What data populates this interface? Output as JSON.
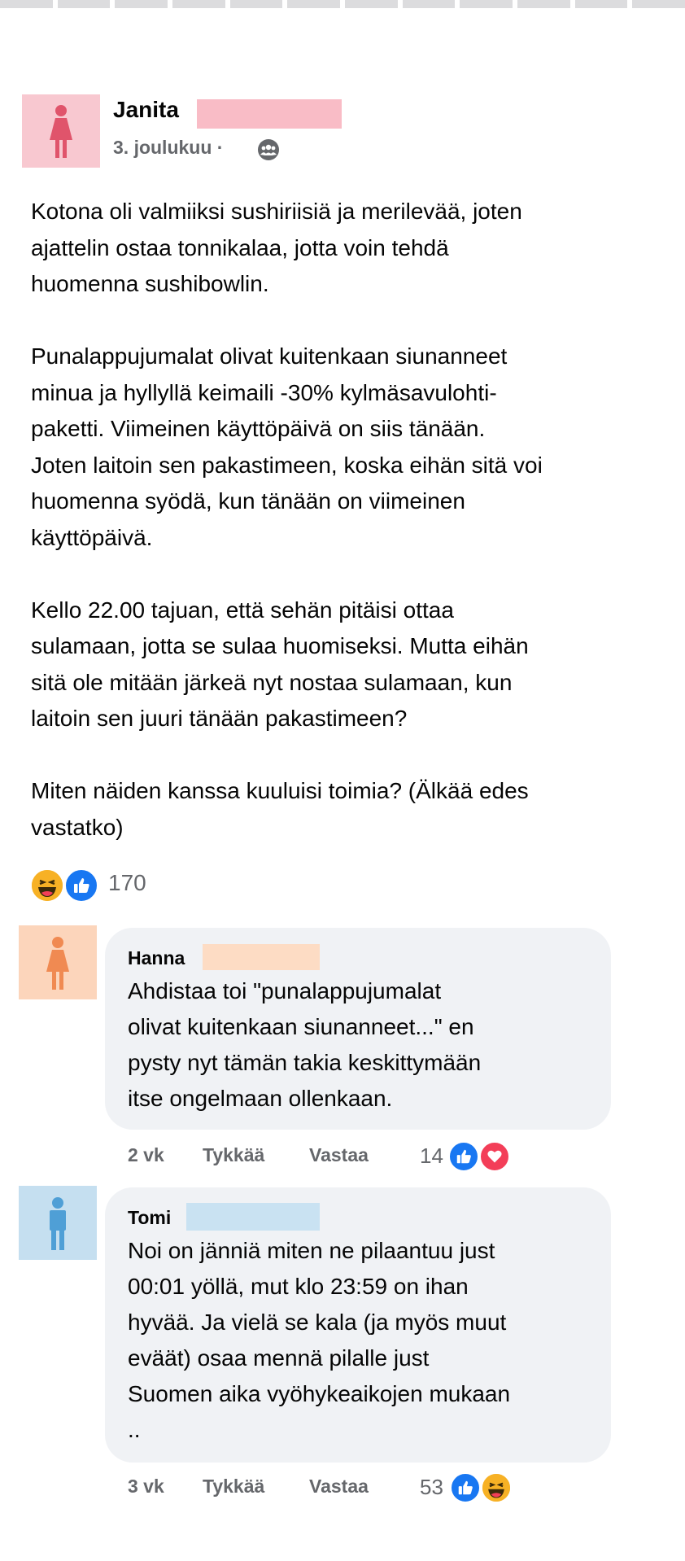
{
  "post": {
    "author": "Janita",
    "date": "3. joulukuu",
    "separator": "·",
    "privacy_icon": "group-icon",
    "text": "Kotona oli valmiiksi sushiriisiä ja merilevää, joten\najattelin ostaa tonnikalaa, jotta voin tehdä\nhuomenna sushibowlin.\n\nPunalappujumalat olivat kuitenkaan siunanneet\nminua ja hyllyllä keimaili -30% kylmäsavulohti-\npaketti. Viimeinen käyttöpäivä on siis tänään.\nJoten laitoin sen pakastimeen, koska eihän sitä voi\nhuomenna syödä, kun tänään on viimeinen\nkäyttöpäivä.\n\nKello 22.00 tajuan, että sehän pitäisi ottaa\nsulamaan, jotta se sulaa huomiseksi. Mutta eihän\nsitä ole mitään järkeä nyt nostaa sulamaan, kun\nlaitoin sen juuri tänään pakastimeen?\n\nMiten näiden kanssa kuuluisi toimia? (Älkää edes\nvastatko)",
    "reactions": {
      "icons": [
        "haha-icon",
        "like-icon"
      ],
      "count": "170"
    }
  },
  "comments": [
    {
      "author": "Hanna",
      "text": "Ahdistaa toi \"punalappujumalat\nolivat kuitenkaan siunanneet...\" en\npysty nyt tämän takia keskittymään\nitse ongelmaan ollenkaan.",
      "time": "2 vk",
      "like_label": "Tykkää",
      "reply_label": "Vastaa",
      "reaction_count": "14",
      "reaction_icons": [
        "like-icon",
        "love-icon"
      ]
    },
    {
      "author": "Tomi",
      "text": "Noi on jänniä miten ne pilaantuu just\n00:01 yöllä, mut klo 23:59 on ihan\nhyvää. Ja vielä se kala (ja myös muut\neväät) osaa mennä pilalle just\nSuomen aika vyöhykeaikojen mukaan\n..",
      "time": "3 vk",
      "like_label": "Tykkää",
      "reply_label": "Vastaa",
      "reaction_count": "53",
      "reaction_icons": [
        "like-icon",
        "haha-icon"
      ]
    }
  ],
  "colors": {
    "like_blue": "#1877f2",
    "love_red": "#f33e58",
    "haha_yellow": "#f7b125",
    "avatar_janita": "#f8c8d0",
    "avatar_hanna": "#fcd5bb",
    "avatar_tomi": "#c5dff0"
  }
}
